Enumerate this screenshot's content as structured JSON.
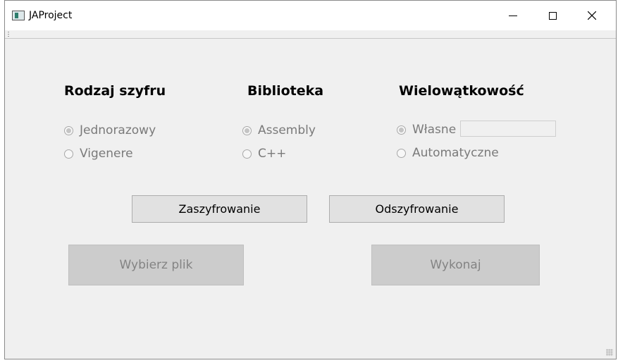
{
  "window": {
    "title": "JAProject"
  },
  "sections": {
    "cipher": {
      "heading": "Rodzaj szyfru",
      "options": [
        {
          "label": "Jednorazowy",
          "checked": true
        },
        {
          "label": "Vigenere",
          "checked": false
        }
      ]
    },
    "library": {
      "heading": "Biblioteka",
      "options": [
        {
          "label": "Assembly",
          "checked": true
        },
        {
          "label": "C++",
          "checked": false
        }
      ]
    },
    "threads": {
      "heading": "Wielowątkowość",
      "options": [
        {
          "label": "Własne",
          "checked": true
        },
        {
          "label": "Automatyczne",
          "checked": false
        }
      ],
      "custom_value": ""
    }
  },
  "buttons": {
    "encrypt": "Zaszyfrowanie",
    "decrypt": "Odszyfrowanie",
    "choose_file": "Wybierz plik",
    "execute": "Wykonaj"
  },
  "icons": [
    "app-icon",
    "minimize-icon",
    "maximize-icon",
    "close-icon",
    "toolbar-grip-icon",
    "size-grip-icon"
  ]
}
